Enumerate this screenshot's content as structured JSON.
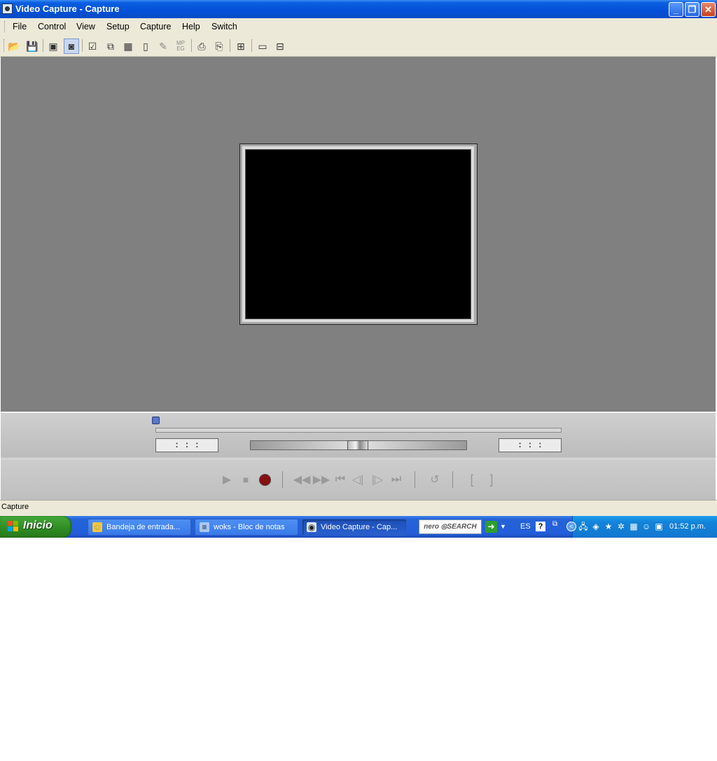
{
  "window": {
    "title": "Video Capture - Capture",
    "controls": {
      "minimize": "_",
      "restore": "❐",
      "close": "✕"
    }
  },
  "menu": [
    "File",
    "Control",
    "View",
    "Setup",
    "Capture",
    "Help",
    "Switch"
  ],
  "toolbar": {
    "icons": [
      "open-icon",
      "save-icon",
      "capture-preview-icon",
      "capture-mode-icon",
      "check-icon",
      "overlay-icon",
      "video-format-icon",
      "video-source-icon",
      "audio-icon",
      "mpeg-icon",
      "snapshot-icon",
      "snapshot-save-icon",
      "frames-icon",
      "display-icon",
      "grid-icon"
    ],
    "mpeg_label": "MP EG"
  },
  "viewer": {
    "background": "#808080",
    "video_color": "#000000"
  },
  "timeline": {
    "start_time": ": : :",
    "end_time": ": : :",
    "position": 0
  },
  "transport": {
    "buttons": [
      "play",
      "stop",
      "record",
      "rewind",
      "fast-forward",
      "go-to-start",
      "step-back",
      "step-forward",
      "go-to-end",
      "loop",
      "mark-in",
      "mark-out"
    ]
  },
  "status_bar": {
    "text": "Capture"
  },
  "taskbar": {
    "start_label": "Inicio",
    "tasks": [
      {
        "label": "Bandeja de entrada...",
        "icon": "email-icon"
      },
      {
        "label": "woks - Bloc de notas",
        "icon": "notepad-icon"
      },
      {
        "label": "Video Capture - Cap...",
        "icon": "video-capture-icon",
        "active": true
      }
    ],
    "search_brand": "nero ◎SEARCH",
    "language": "ES",
    "clock": "01:52 p.m."
  }
}
